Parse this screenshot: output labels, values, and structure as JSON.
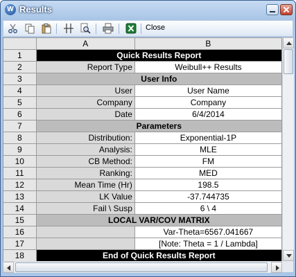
{
  "window": {
    "title": "Results",
    "app_icon": "W",
    "accent": "#a9c6e8"
  },
  "toolbar": {
    "close_label": "Close",
    "icons": [
      "cut-icon",
      "copy-icon",
      "paste-icon",
      "column-icon",
      "print-preview-icon",
      "print-icon",
      "excel-icon"
    ]
  },
  "sheet": {
    "columns": [
      "A",
      "B"
    ],
    "rows": [
      {
        "n": "1",
        "type": "black",
        "text": "Quick Results Report"
      },
      {
        "n": "2",
        "type": "pair",
        "a": "Report Type",
        "b": "Weibull++ Results"
      },
      {
        "n": "3",
        "type": "gray",
        "text": "User Info"
      },
      {
        "n": "4",
        "type": "pair",
        "a": "User",
        "b": "User Name"
      },
      {
        "n": "5",
        "type": "pair",
        "a": "Company",
        "b": "Company"
      },
      {
        "n": "6",
        "type": "pair",
        "a": "Date",
        "b": "6/4/2014"
      },
      {
        "n": "7",
        "type": "gray",
        "text": "Parameters"
      },
      {
        "n": "8",
        "type": "pair",
        "a": "Distribution:",
        "b": "Exponential-1P"
      },
      {
        "n": "9",
        "type": "pair",
        "a": "Analysis:",
        "b": "MLE"
      },
      {
        "n": "10",
        "type": "pair",
        "a": "CB Method:",
        "b": "FM"
      },
      {
        "n": "11",
        "type": "pair",
        "a": "Ranking:",
        "b": "MED"
      },
      {
        "n": "12",
        "type": "pair",
        "a": "Mean Time (Hr)",
        "b": "198.5"
      },
      {
        "n": "13",
        "type": "pair",
        "a": "LK Value",
        "b": "-37.744735"
      },
      {
        "n": "14",
        "type": "pair",
        "a": "Fail \\ Susp",
        "b": "6 \\ 4"
      },
      {
        "n": "15",
        "type": "gray",
        "text": "LOCAL VAR/COV MATRIX"
      },
      {
        "n": "16",
        "type": "pair",
        "a": "",
        "b": "Var-Theta=6567.041667"
      },
      {
        "n": "17",
        "type": "pair",
        "a": "",
        "b": "[Note: Theta = 1 / Lambda]"
      },
      {
        "n": "18",
        "type": "black",
        "text": "End of Quick Results Report"
      }
    ]
  }
}
